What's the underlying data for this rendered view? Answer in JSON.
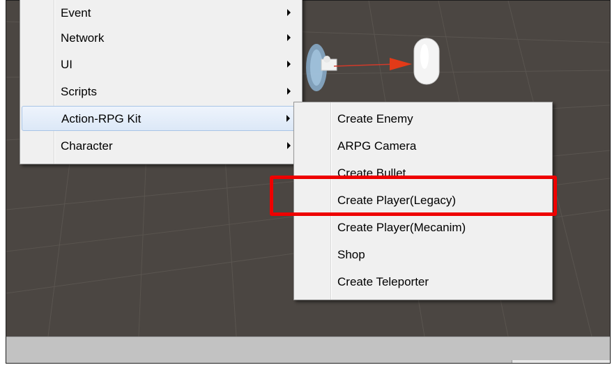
{
  "main_menu": {
    "items": [
      {
        "label": "Event"
      },
      {
        "label": "Network"
      },
      {
        "label": "UI"
      },
      {
        "label": "Scripts"
      },
      {
        "label": "Action-RPG Kit"
      },
      {
        "label": "Character"
      }
    ]
  },
  "submenu": {
    "items": [
      {
        "label": "Create Enemy"
      },
      {
        "label": "ARPG Camera"
      },
      {
        "label": "Create Bullet"
      },
      {
        "label": "Create Player(Legacy)"
      },
      {
        "label": "Create Player(Mecanim)"
      },
      {
        "label": "Shop"
      },
      {
        "label": "Create Teleporter"
      }
    ]
  },
  "colors": {
    "highlight": "#ee0000",
    "scene_background": "#4b4642",
    "menu_background": "#f0f0f0"
  }
}
